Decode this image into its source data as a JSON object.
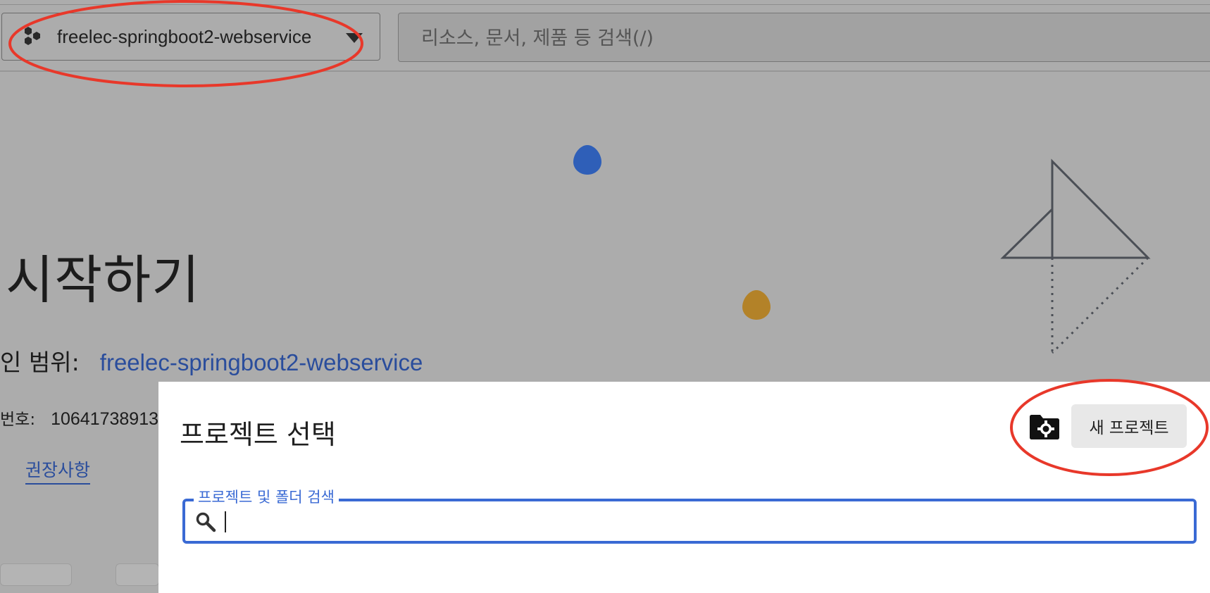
{
  "topbar": {
    "project_name": "freelec-springboot2-webservice",
    "search_placeholder": "리소스, 문서, 제품 등 검색(/)"
  },
  "main": {
    "title": "시작하기",
    "scope_label": "인 범위:",
    "scope_value": "freelec-springboot2-webservice",
    "number_label": "번호:",
    "number_value": "10641738913",
    "recommendations_link": "권장사항"
  },
  "dialog": {
    "title": "프로젝트 선택",
    "new_project_label": "새 프로젝트",
    "search_label": "프로젝트 및 폴더 검색",
    "search_value": ""
  },
  "colors": {
    "overlay_gray": "#acacac",
    "link_blue": "#2a4d9c",
    "focus_blue": "#3a6ad4",
    "annotation_red": "#e8382a",
    "deco_blue": "#2f5fb8",
    "deco_gold": "#b38228"
  },
  "icons": {
    "project_icon": "hexagon-cluster-icon",
    "dropdown_icon": "caret-down-icon",
    "folder_settings_icon": "folder-gear-icon",
    "search_icon": "magnifier-icon"
  }
}
